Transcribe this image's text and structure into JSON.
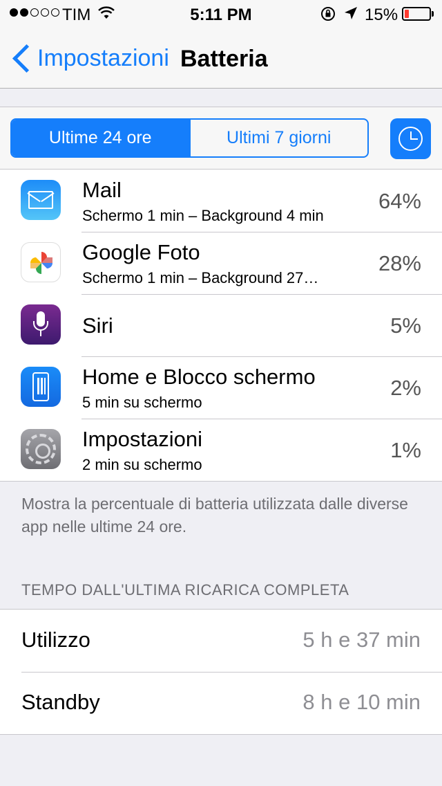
{
  "status_bar": {
    "carrier": "TIM",
    "time": "5:11 PM",
    "battery_percent": "15%",
    "battery_level": 0.15,
    "signal_bars_filled": 2,
    "signal_bars_total": 5,
    "icons": [
      "wifi-icon",
      "rotation-lock-icon",
      "location-icon",
      "battery-icon"
    ]
  },
  "nav": {
    "back_label": "Impostazioni",
    "title": "Batteria"
  },
  "segmented": {
    "options": [
      "Ultime 24 ore",
      "Ultimi 7 giorni"
    ],
    "selected": "Ultime 24 ore"
  },
  "apps": [
    {
      "name": "Mail",
      "detail": "Schermo 1 min – Background 4 min",
      "percent": "64%",
      "icon": "mail-icon"
    },
    {
      "name": "Google Foto",
      "detail": "Schermo 1 min – Background 27…",
      "percent": "28%",
      "icon": "google-photos-icon"
    },
    {
      "name": "Siri",
      "detail": "",
      "percent": "5%",
      "icon": "siri-icon"
    },
    {
      "name": "Home e Blocco schermo",
      "detail": "5 min su schermo",
      "percent": "2%",
      "icon": "home-lock-screen-icon"
    },
    {
      "name": "Impostazioni",
      "detail": "2 min su schermo",
      "percent": "1%",
      "icon": "settings-icon"
    }
  ],
  "note": "Mostra la percentuale di batteria utilizzata dalle diverse app nelle ultime 24 ore.",
  "since_charge": {
    "header": "TEMPO DALL'ULTIMA RICARICA COMPLETA",
    "rows": [
      {
        "label": "Utilizzo",
        "value": "5 h e 37 min"
      },
      {
        "label": "Standby",
        "value": "8 h e 10 min"
      }
    ]
  },
  "colors": {
    "accent": "#157efb",
    "battery_low": "#ff3b30",
    "background": "#efeff4"
  }
}
